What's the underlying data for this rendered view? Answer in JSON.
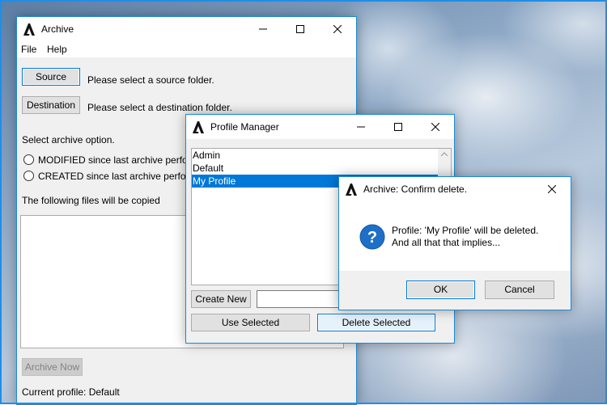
{
  "archive_window": {
    "title": "Archive",
    "menu": [
      "File",
      "Help"
    ],
    "source_button": "Source",
    "source_status": "Please select a source folder.",
    "destination_button": "Destination",
    "destination_status": "Please select a destination folder.",
    "option_label": "Select archive option.",
    "option_modified": "MODIFIED since last archive performed.",
    "option_created": "CREATED  since last archive performed.",
    "files_label": "The following files will be copied",
    "archive_now_button": "Archive Now",
    "current_profile": "Current profile: Default"
  },
  "profile_manager": {
    "title": "Profile Manager",
    "profiles": [
      "Admin",
      "Default",
      "My Profile"
    ],
    "selected_index": 2,
    "create_new_button": "Create New",
    "new_profile_value": "",
    "use_selected_button": "Use Selected",
    "delete_selected_button": "Delete Selected"
  },
  "confirm_dialog": {
    "title": "Archive: Confirm delete.",
    "message_line1": "Profile: 'My Profile' will be deleted.",
    "message_line2": "And all that that implies...",
    "ok_button": "OK",
    "cancel_button": "Cancel",
    "icon": "question-icon"
  },
  "colors": {
    "accent": "#0078d7",
    "window_border": "#1a8ad4",
    "question_icon": "#1e6fc7"
  }
}
